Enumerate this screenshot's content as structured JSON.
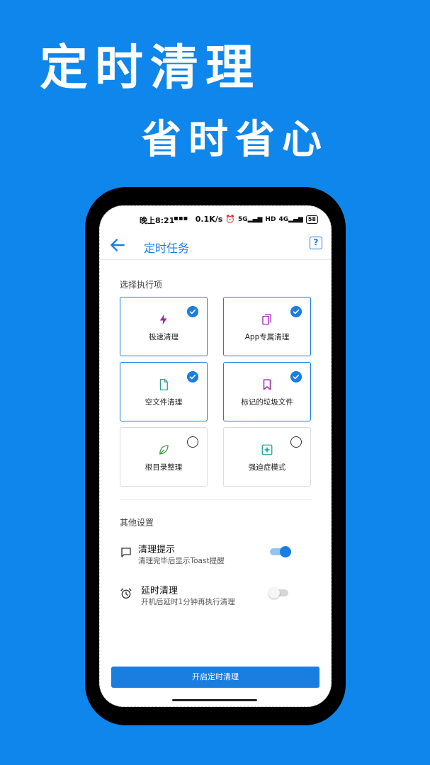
{
  "promo": {
    "headline": "定时清理",
    "subheadline": "省时省心"
  },
  "status_bar": {
    "time": "晚上8:21",
    "message_icon": "message-icon",
    "speed": "0.1K/s",
    "alarm_icon": "alarm-icon",
    "signal1": "5G",
    "hd": "HD",
    "signal2": "4G",
    "battery": "58"
  },
  "app_bar": {
    "title": "定时任务",
    "help": "?"
  },
  "section1": {
    "title": "选择执行项",
    "items": [
      {
        "label": "极速清理",
        "icon": "lightning-icon",
        "checked": true
      },
      {
        "label": "App专属清理",
        "icon": "copy-icon",
        "checked": true
      },
      {
        "label": "空文件清理",
        "icon": "file-icon",
        "checked": true
      },
      {
        "label": "标记的垃圾文件",
        "icon": "bookmark-icon",
        "checked": true
      },
      {
        "label": "根目录整理",
        "icon": "leaf-icon",
        "checked": false
      },
      {
        "label": "强迫症模式",
        "icon": "sparkle-icon",
        "checked": false
      }
    ]
  },
  "section2": {
    "title": "其他设置",
    "settings": [
      {
        "title": "清理提示",
        "subtitle": "清理完毕后显示Toast提醒",
        "icon": "message-square-icon",
        "enabled": true
      },
      {
        "title": "延时清理",
        "subtitle": "开机后延时1分钟再执行清理",
        "icon": "alarm-icon",
        "enabled": false
      }
    ]
  },
  "cta": {
    "label": "开启定时清理"
  },
  "colors": {
    "background": "#0e86ec",
    "accent": "#1a7de0",
    "purple": "#9c27b0",
    "teal": "#26a69a",
    "green": "#43a047"
  }
}
